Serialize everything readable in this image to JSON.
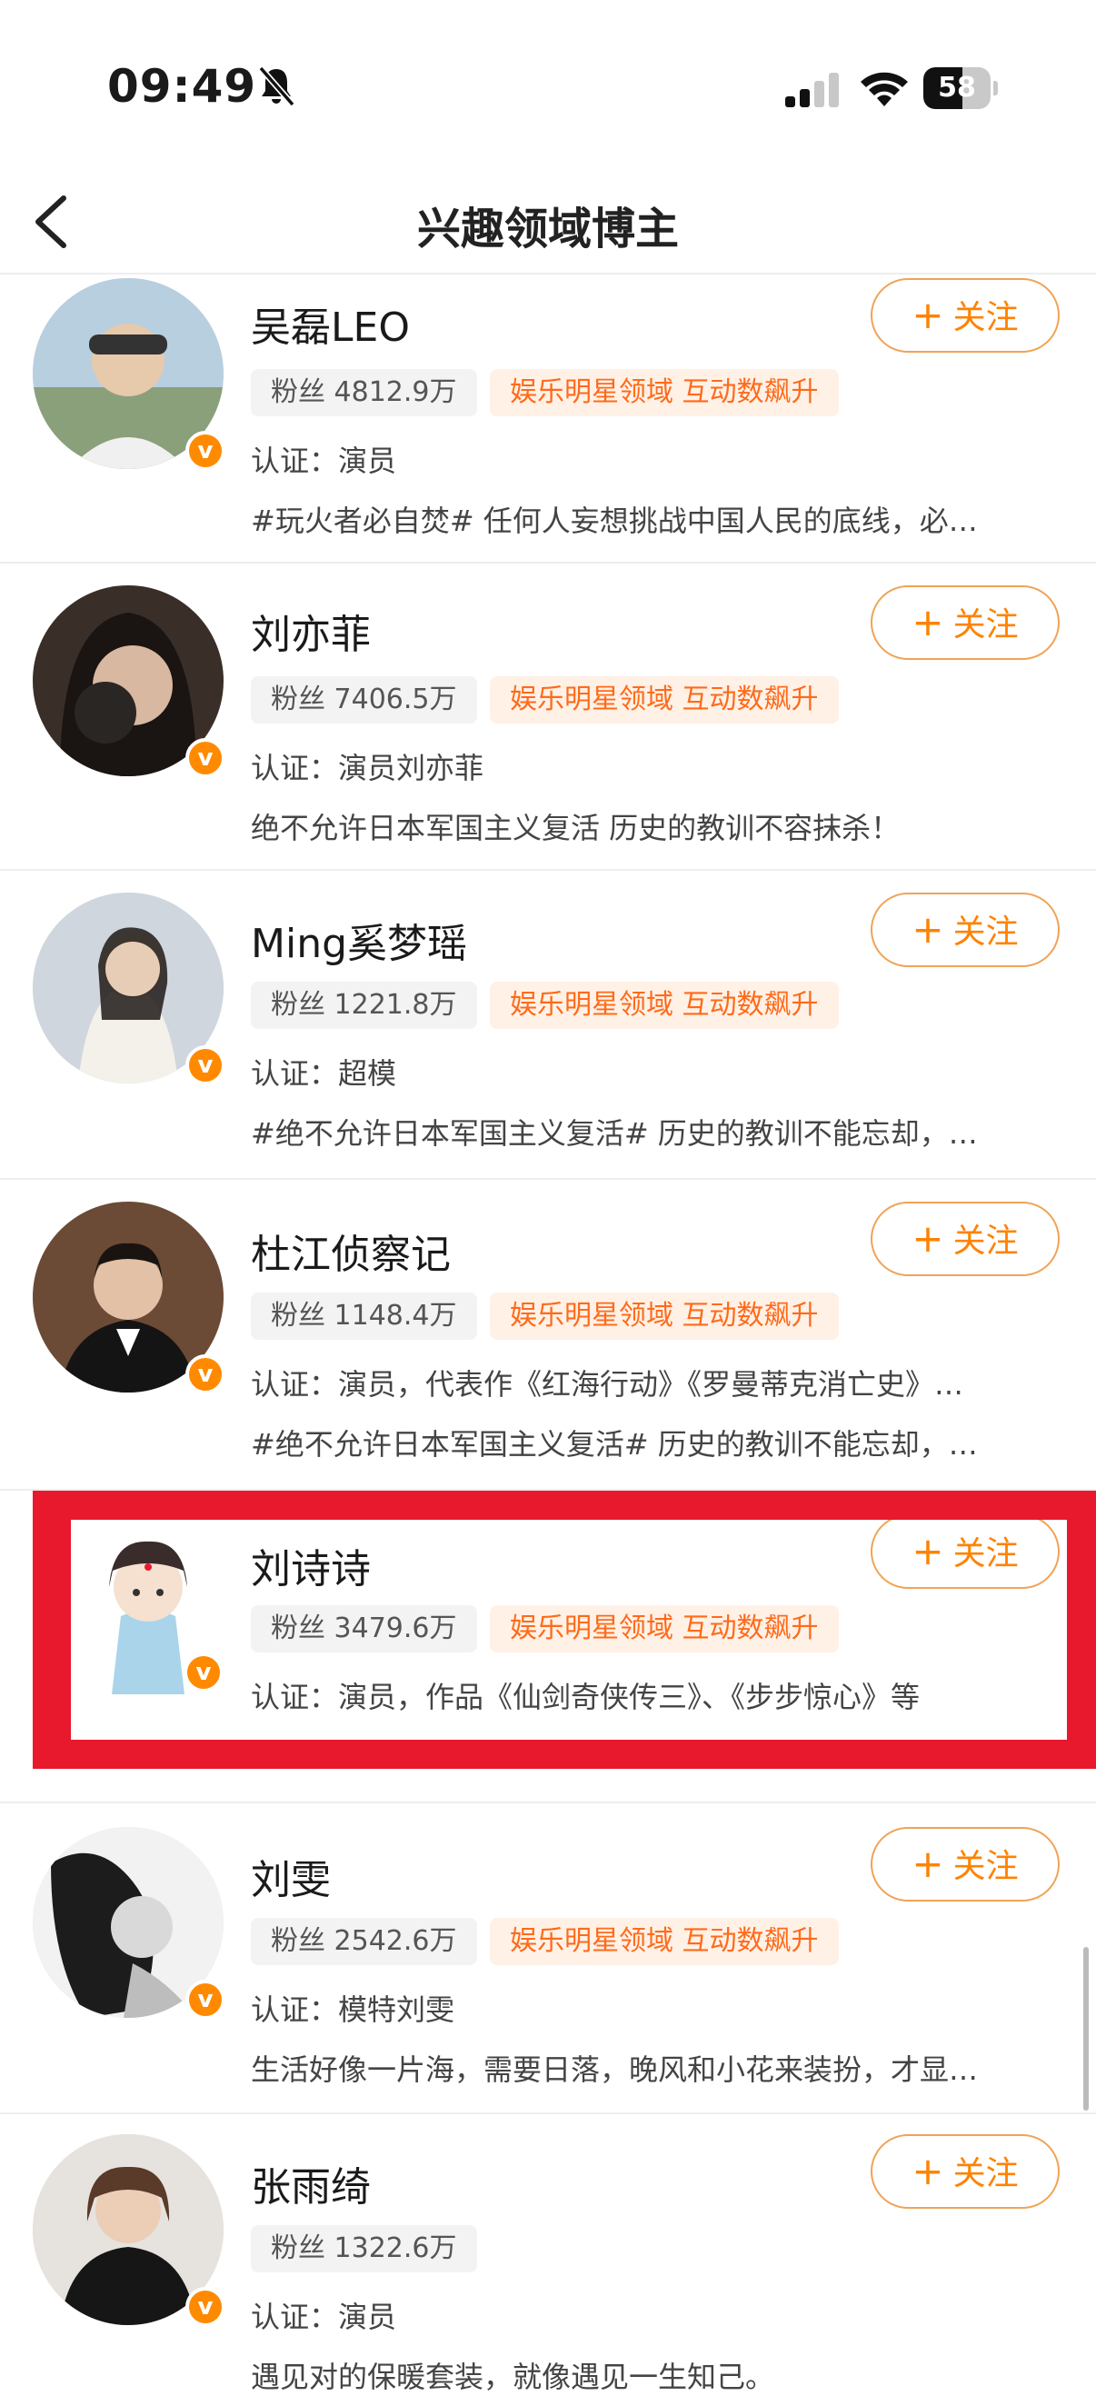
{
  "status_bar": {
    "time": "09:49",
    "battery": "58",
    "battery_level": 0.58
  },
  "nav": {
    "title": "兴趣领域博主"
  },
  "list": [
    {
      "name": "吴磊LEO",
      "follow": "关注",
      "fans": "粉丝 4812.9万",
      "tag": "娱乐明星领域 互动数飙升",
      "cert": "认证：演员",
      "desc": "#玩火者必自焚# 任何人妄想挑战中国人民的底线，必…"
    },
    {
      "name": "刘亦菲",
      "follow": "关注",
      "fans": "粉丝 7406.5万",
      "tag": "娱乐明星领域 互动数飙升",
      "cert": "认证：演员刘亦菲",
      "desc": "绝不允许日本军国主义复活 历史的教训不容抹杀！"
    },
    {
      "name": "Ming奚梦瑶",
      "follow": "关注",
      "fans": "粉丝 1221.8万",
      "tag": "娱乐明星领域 互动数飙升",
      "cert": "认证：超模",
      "desc": "#绝不允许日本军国主义复活# 历史的教训不能忘却，…"
    },
    {
      "name": "杜江侦察记",
      "follow": "关注",
      "fans": "粉丝 1148.4万",
      "tag": "娱乐明星领域 互动数飙升",
      "cert": "认证：演员，代表作《红海行动》《罗曼蒂克消亡史》…",
      "desc": "#绝不允许日本军国主义复活# 历史的教训不能忘却，…"
    },
    {
      "name": "刘诗诗",
      "follow": "关注",
      "fans": "粉丝 3479.6万",
      "tag": "娱乐明星领域 互动数飙升",
      "cert": "认证：演员，作品《仙剑奇侠传三》、《步步惊心》等",
      "desc": ""
    },
    {
      "name": "刘雯",
      "follow": "关注",
      "fans": "粉丝 2542.6万",
      "tag": "娱乐明星领域 互动数飙升",
      "cert": "认证：模特刘雯",
      "desc": "生活好像一片海，需要日落，晚风和小花来装扮，才显…"
    },
    {
      "name": "张雨绮",
      "follow": "关注",
      "fans": "粉丝 1322.6万",
      "tag": "娱乐明星领域 互动数飙升",
      "cert": "认证：演员",
      "desc": "遇见对的保暖套装，就像遇见一生知己。"
    }
  ],
  "colors": {
    "accent": "#ff8200",
    "tag_text": "#ff6a1a",
    "tag_bg": "#fff1e6",
    "highlight": "#e8192c"
  },
  "icons": [
    "bell-slash-icon",
    "signal-icon",
    "wifi-icon",
    "battery-icon",
    "back-arrow-icon",
    "plus-icon",
    "verified-v-icon"
  ]
}
